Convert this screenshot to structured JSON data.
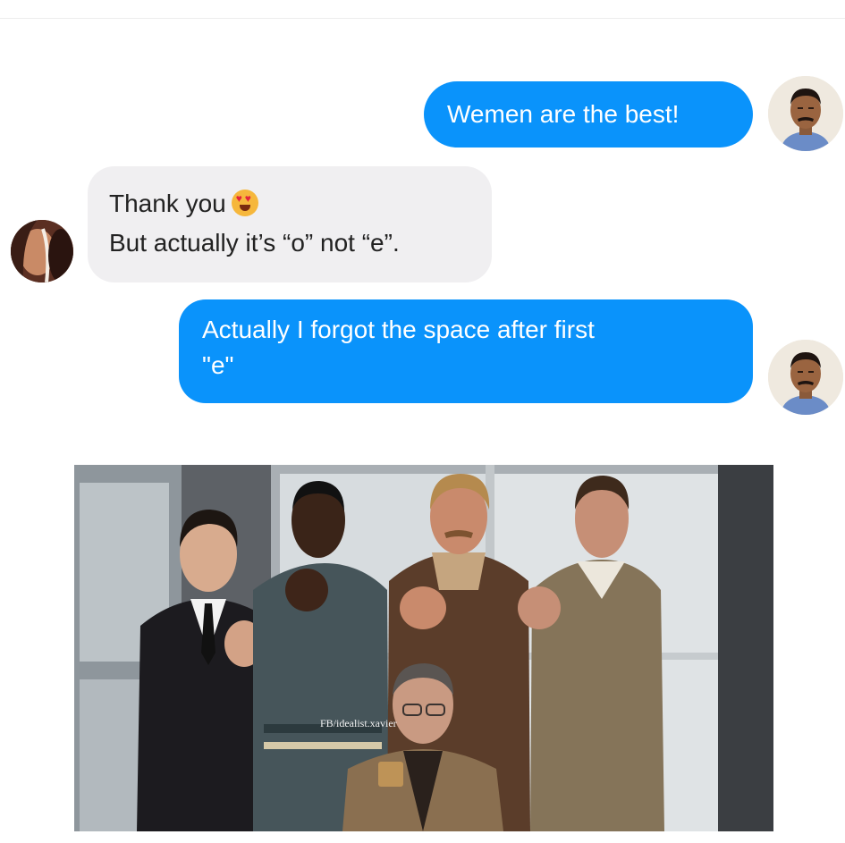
{
  "messages": [
    {
      "sender": "me",
      "lines": [
        "Wemen are the best!"
      ]
    },
    {
      "sender": "other",
      "lines": [
        "Thank you",
        "But actually it’s “o” not “e”."
      ],
      "emoji": "heart-eyes"
    },
    {
      "sender": "me",
      "lines": [
        "Actually I forgot the space after first",
        "\"e\""
      ]
    }
  ],
  "photo": {
    "watermark": "FB/idealist.xavier"
  },
  "colors": {
    "sent_bubble": "#0a93fb",
    "received_bubble": "#f0eff1",
    "background": "#ffffff"
  }
}
